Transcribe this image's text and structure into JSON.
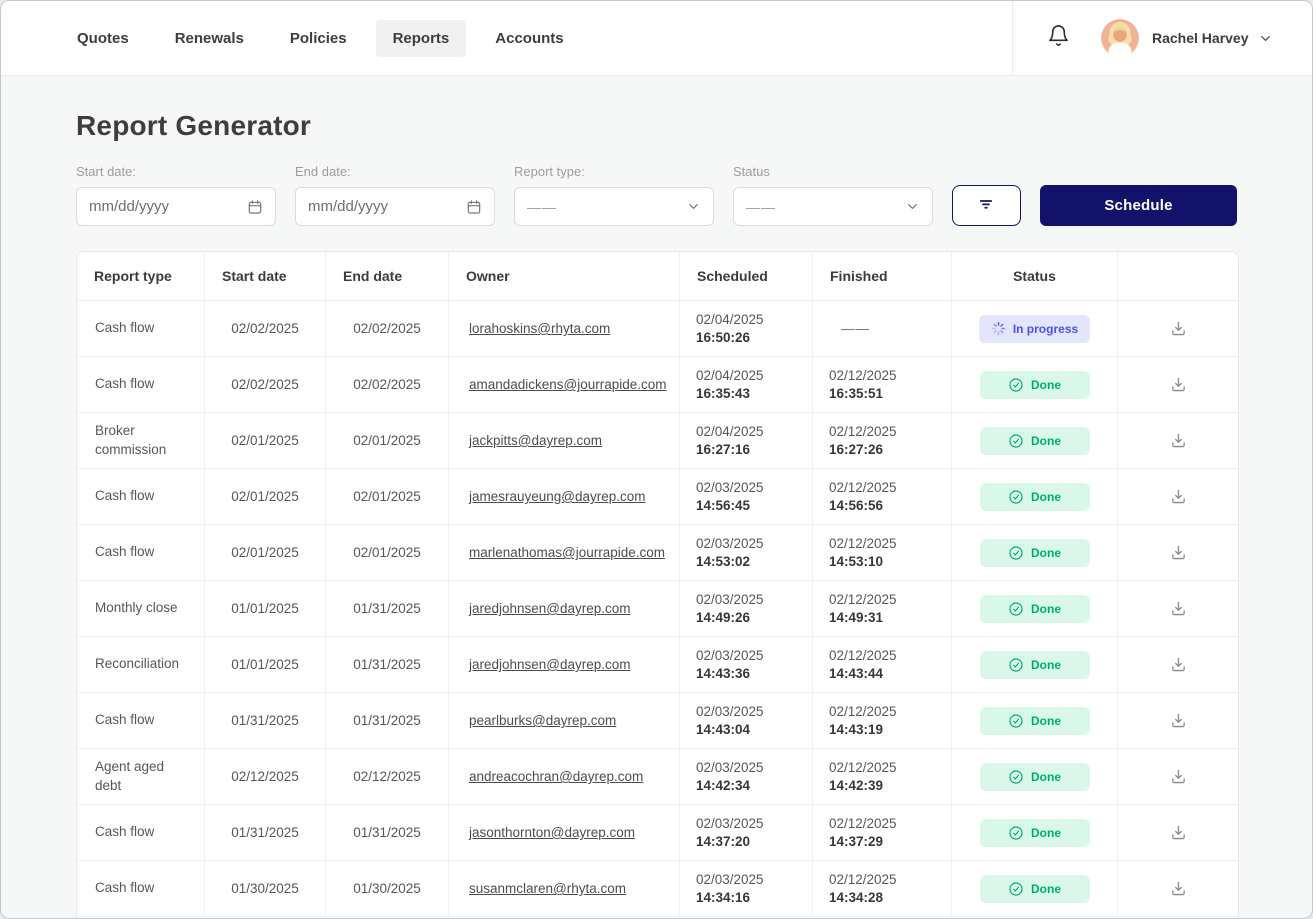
{
  "colors": {
    "accent": "#12126b",
    "in_progress_bg": "#e3e5fb",
    "in_progress_fg": "#4b51e3",
    "done_bg": "#d9f8ea",
    "done_fg": "#00ab70"
  },
  "nav": {
    "items": [
      {
        "label": "Quotes",
        "active": false
      },
      {
        "label": "Renewals",
        "active": false
      },
      {
        "label": "Policies",
        "active": false
      },
      {
        "label": "Reports",
        "active": true
      },
      {
        "label": "Accounts",
        "active": false
      }
    ]
  },
  "header": {
    "bell_icon": "bell-icon",
    "user": {
      "name": "Rachel Harvey",
      "avatar_icon": "avatar-photo",
      "chevron_icon": "chevron-down-icon"
    }
  },
  "page": {
    "title": "Report Generator"
  },
  "filters": {
    "start_date": {
      "label": "Start date:",
      "placeholder": "mm/dd/yyyy",
      "icon": "calendar-icon"
    },
    "end_date": {
      "label": "End date:",
      "placeholder": "mm/dd/yyyy",
      "icon": "calendar-icon"
    },
    "report_type": {
      "label": "Report type:",
      "value": "——",
      "icon": "chevron-down-icon"
    },
    "status": {
      "label": "Status",
      "value": "——",
      "icon": "chevron-down-icon"
    },
    "filter_button_icon": "filter-icon",
    "schedule_button_label": "Schedule"
  },
  "table": {
    "columns": [
      "Report type",
      "Start date",
      "End date",
      "Owner",
      "Scheduled",
      "Finished",
      "Status",
      ""
    ],
    "row_action_icon": "download-icon",
    "empty_placeholder": "——",
    "rows": [
      {
        "report_type": "Cash flow",
        "start_date": "02/02/2025",
        "end_date": "02/02/2025",
        "owner": "lorahoskins@rhyta.com",
        "scheduled": {
          "date": "02/04/2025",
          "time": "16:50:26"
        },
        "finished": {
          "date": "",
          "time": ""
        },
        "status": {
          "label": "In progress",
          "state": "in_progress",
          "icon": "spinner-icon"
        }
      },
      {
        "report_type": "Cash flow",
        "start_date": "02/02/2025",
        "end_date": "02/02/2025",
        "owner": "amandadickens@jourrapide.com",
        "scheduled": {
          "date": "02/04/2025",
          "time": "16:35:43"
        },
        "finished": {
          "date": "02/12/2025",
          "time": "16:35:51"
        },
        "status": {
          "label": "Done",
          "state": "done",
          "icon": "check-circle-icon"
        }
      },
      {
        "report_type": "Broker commission",
        "start_date": "02/01/2025",
        "end_date": "02/01/2025",
        "owner": "jackpitts@dayrep.com",
        "scheduled": {
          "date": "02/04/2025",
          "time": "16:27:16"
        },
        "finished": {
          "date": "02/12/2025",
          "time": "16:27:26"
        },
        "status": {
          "label": "Done",
          "state": "done",
          "icon": "check-circle-icon"
        }
      },
      {
        "report_type": "Cash flow",
        "start_date": "02/01/2025",
        "end_date": "02/01/2025",
        "owner": "jamesrauyeung@dayrep.com",
        "scheduled": {
          "date": "02/03/2025",
          "time": "14:56:45"
        },
        "finished": {
          "date": "02/12/2025",
          "time": "14:56:56"
        },
        "status": {
          "label": "Done",
          "state": "done",
          "icon": "check-circle-icon"
        }
      },
      {
        "report_type": "Cash flow",
        "start_date": "02/01/2025",
        "end_date": "02/01/2025",
        "owner": "marlenathomas@jourrapide.com",
        "scheduled": {
          "date": "02/03/2025",
          "time": "14:53:02"
        },
        "finished": {
          "date": "02/12/2025",
          "time": "14:53:10"
        },
        "status": {
          "label": "Done",
          "state": "done",
          "icon": "check-circle-icon"
        }
      },
      {
        "report_type": "Monthly close",
        "start_date": "01/01/2025",
        "end_date": "01/31/2025",
        "owner": "jaredjohnsen@dayrep.com",
        "scheduled": {
          "date": "02/03/2025",
          "time": "14:49:26"
        },
        "finished": {
          "date": "02/12/2025",
          "time": "14:49:31"
        },
        "status": {
          "label": "Done",
          "state": "done",
          "icon": "check-circle-icon"
        }
      },
      {
        "report_type": "Reconciliation",
        "start_date": "01/01/2025",
        "end_date": "01/31/2025",
        "owner": "jaredjohnsen@dayrep.com",
        "scheduled": {
          "date": "02/03/2025",
          "time": "14:43:36"
        },
        "finished": {
          "date": "02/12/2025",
          "time": "14:43:44"
        },
        "status": {
          "label": "Done",
          "state": "done",
          "icon": "check-circle-icon"
        }
      },
      {
        "report_type": "Cash flow",
        "start_date": "01/31/2025",
        "end_date": "01/31/2025",
        "owner": "pearlburks@dayrep.com",
        "scheduled": {
          "date": "02/03/2025",
          "time": "14:43:04"
        },
        "finished": {
          "date": "02/12/2025",
          "time": "14:43:19"
        },
        "status": {
          "label": "Done",
          "state": "done",
          "icon": "check-circle-icon"
        }
      },
      {
        "report_type": "Agent aged debt",
        "start_date": "02/12/2025",
        "end_date": "02/12/2025",
        "owner": "andreacochran@dayrep.com",
        "scheduled": {
          "date": "02/03/2025",
          "time": "14:42:34"
        },
        "finished": {
          "date": "02/12/2025",
          "time": "14:42:39"
        },
        "status": {
          "label": "Done",
          "state": "done",
          "icon": "check-circle-icon"
        }
      },
      {
        "report_type": "Cash flow",
        "start_date": "01/31/2025",
        "end_date": "01/31/2025",
        "owner": "jasonthornton@dayrep.com",
        "scheduled": {
          "date": "02/03/2025",
          "time": "14:37:20"
        },
        "finished": {
          "date": "02/12/2025",
          "time": "14:37:29"
        },
        "status": {
          "label": "Done",
          "state": "done",
          "icon": "check-circle-icon"
        }
      },
      {
        "report_type": "Cash flow",
        "start_date": "01/30/2025",
        "end_date": "01/30/2025",
        "owner": "susanmclaren@rhyta.com",
        "scheduled": {
          "date": "02/03/2025",
          "time": "14:34:16"
        },
        "finished": {
          "date": "02/12/2025",
          "time": "14:34:28"
        },
        "status": {
          "label": "Done",
          "state": "done",
          "icon": "check-circle-icon"
        }
      }
    ]
  }
}
